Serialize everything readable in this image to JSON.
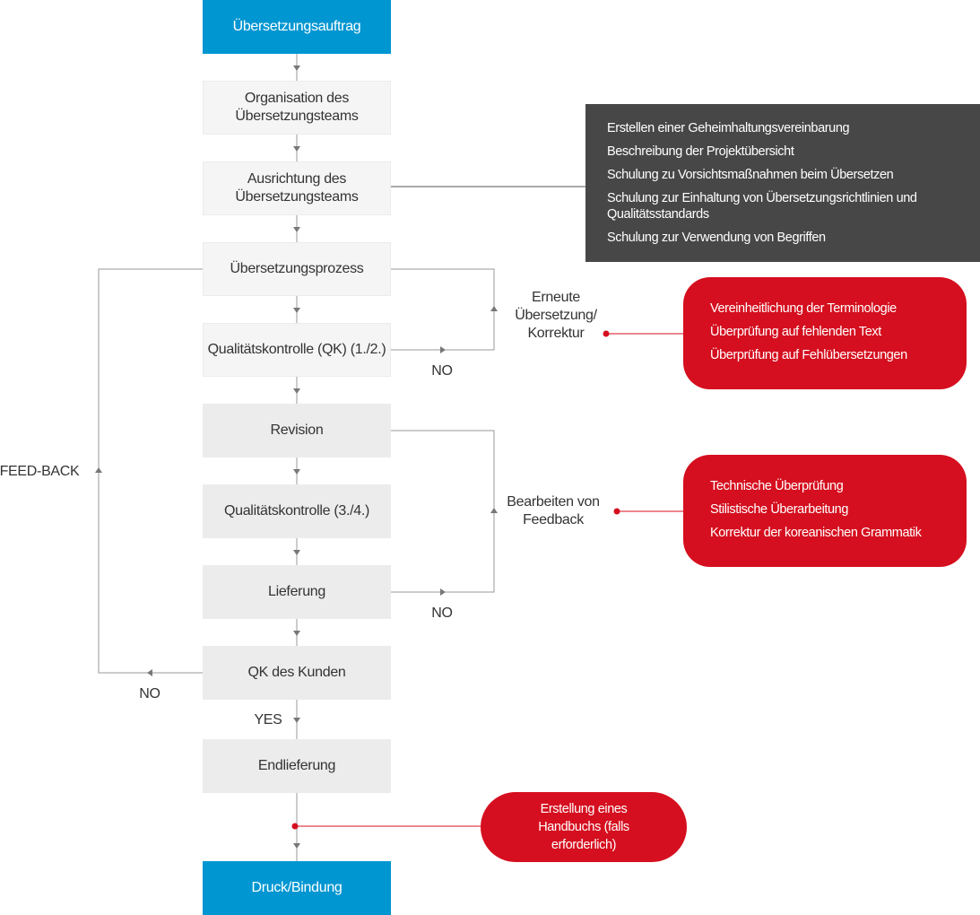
{
  "colors": {
    "blue": "#0096d1",
    "red": "#d50f1f",
    "dark": "#474747",
    "line": "#9a9a9a"
  },
  "steps": [
    "Übersetzungsauftrag",
    "Organisation des Übersetzungsteams",
    "Ausrichtung des Übersetzungsteams",
    "Übersetzungsprozess",
    "Qualitätskontrolle (QK) (1./2.)",
    "Revision",
    "Qualitätskontrolle (3./4.)",
    "Lieferung",
    "QK des Kunden",
    "Endlieferung",
    "Druck/Bindung"
  ],
  "labels": {
    "no1": "NO",
    "no2": "NO",
    "no3": "NO",
    "yes": "YES",
    "feedback": "FEED-BACK",
    "retranslate": "Erneute Übersetzung/ Korrektur",
    "edit_feedback": "Bearbeiten von Feedback"
  },
  "team_alignment_notes": [
    "Erstellen einer Geheimhaltungsvereinbarung",
    "Beschreibung der Projektübersicht",
    "Schulung zu Vorsichtsmaßnahmen beim Übersetzen",
    "Schulung zur Einhaltung von Übersetzungsrichtlinien und Qualitätsstandards",
    "Schulung zur Verwendung von Begriffen"
  ],
  "retranslate_notes": [
    "Vereinheitlichung der Terminologie",
    "Überprüfung auf fehlenden Text",
    "Überprüfung auf Fehlübersetzungen"
  ],
  "feedback_notes": [
    "Technische Überprüfung",
    "Stilistische Überarbeitung",
    "Korrektur der koreanischen Grammatik"
  ],
  "manual_note": "Erstellung eines Handbuchs (falls erforderlich)"
}
